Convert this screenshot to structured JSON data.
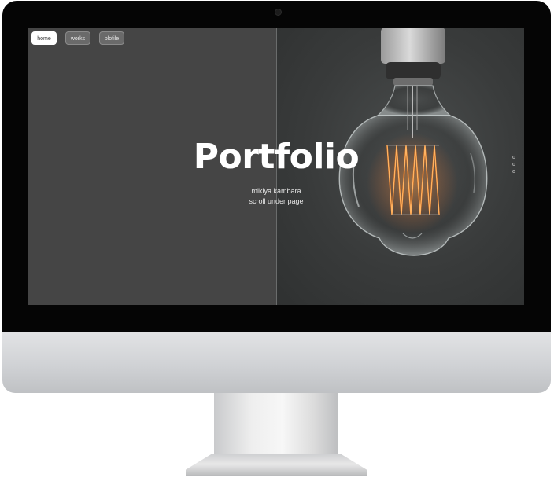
{
  "nav": {
    "items": [
      {
        "label": "home",
        "active": true
      },
      {
        "label": "works",
        "active": false
      },
      {
        "label": "plofile",
        "active": false
      }
    ]
  },
  "hero": {
    "title": "Portfolio",
    "subtitle_line1": "mikiya kambara",
    "subtitle_line2": "scroll under page"
  },
  "pager": {
    "count": 3,
    "icon": "pagination-dot-icon"
  },
  "colors": {
    "left_pane": "#454545",
    "right_pane": "#3a3c3c",
    "filament": "#ff8a2a",
    "bezel": "#050505",
    "frame_silver": "#d0d2d5"
  }
}
